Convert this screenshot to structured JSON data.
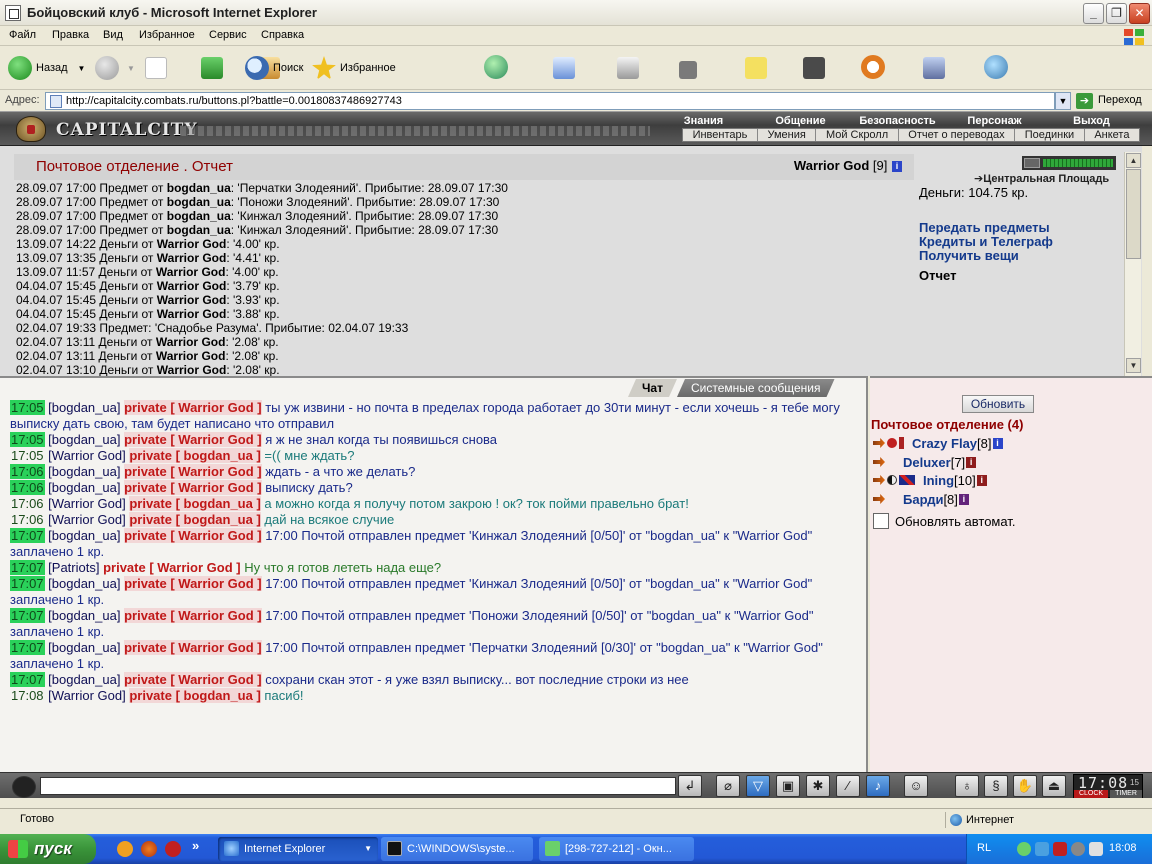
{
  "window": {
    "title": "Бойцовский клуб - Microsoft Internet Explorer",
    "min_glyph": "_",
    "max_glyph": "❐",
    "close_glyph": "✕"
  },
  "menu": [
    "Файл",
    "Правка",
    "Вид",
    "Избранное",
    "Сервис",
    "Справка"
  ],
  "toolbar": {
    "back": "Назад",
    "search": "Поиск",
    "favorites": "Избранное"
  },
  "address": {
    "label": "Адрес:",
    "url": "http://capitalcity.combats.ru/buttons.pl?battle=0.00180837486927743",
    "go": "Переход"
  },
  "game": {
    "logo": "CAPITALCITY",
    "nav_top": [
      "Знания",
      "Общение",
      "Безопасность",
      "Персонаж",
      "Выход"
    ],
    "nav_bottom": [
      "Инвентарь",
      "Умения",
      "Мой Скролл",
      "Отчет о переводах",
      "Поединки",
      "Анкета"
    ]
  },
  "main": {
    "title": "Почтовое отделение .  Отчет",
    "user_name": "Warrior God",
    "user_level": "[9]",
    "hp_percent": 100,
    "location": "Центральная Площадь",
    "money": "Деньги: 104.75 кр.",
    "links": [
      "Передать предметы",
      "Кредиты и Телеграф",
      "Получить вещи"
    ],
    "current": "Отчет",
    "log": [
      {
        "date": "28.09.07 17:00",
        "kind": "Предмет от",
        "who": "bogdan_ua",
        "rest": ": 'Перчатки Злодеяний'. Прибытие: 28.09.07 17:30"
      },
      {
        "date": "28.09.07 17:00",
        "kind": "Предмет от",
        "who": "bogdan_ua",
        "rest": ": 'Поножи Злодеяний'. Прибытие: 28.09.07 17:30"
      },
      {
        "date": "28.09.07 17:00",
        "kind": "Предмет от",
        "who": "bogdan_ua",
        "rest": ": 'Кинжал Злодеяний'. Прибытие: 28.09.07 17:30"
      },
      {
        "date": "28.09.07 17:00",
        "kind": "Предмет от",
        "who": "bogdan_ua",
        "rest": ": 'Кинжал Злодеяний'. Прибытие: 28.09.07 17:30"
      },
      {
        "date": "13.09.07 14:22",
        "kind": "Деньги от",
        "who": "Warrior God",
        "rest": ": '4.00' кр."
      },
      {
        "date": "13.09.07 13:35",
        "kind": "Деньги от",
        "who": "Warrior God",
        "rest": ": '4.41' кр."
      },
      {
        "date": "13.09.07 11:57",
        "kind": "Деньги от",
        "who": "Warrior God",
        "rest": ": '4.00' кр."
      },
      {
        "date": "04.04.07 15:45",
        "kind": "Деньги от",
        "who": "Warrior God",
        "rest": ": '3.79' кр."
      },
      {
        "date": "04.04.07 15:45",
        "kind": "Деньги от",
        "who": "Warrior God",
        "rest": ": '3.93' кр."
      },
      {
        "date": "04.04.07 15:45",
        "kind": "Деньги от",
        "who": "Warrior God",
        "rest": ": '3.88' кр."
      },
      {
        "date": "02.04.07 19:33",
        "kind": "Предмет:",
        "who": "",
        "rest": " 'Снадобье Разума'. Прибытие: 02.04.07 19:33"
      },
      {
        "date": "02.04.07 13:11",
        "kind": "Деньги от",
        "who": "Warrior God",
        "rest": ": '2.08' кр."
      },
      {
        "date": "02.04.07 13:11",
        "kind": "Деньги от",
        "who": "Warrior God",
        "rest": ": '2.08' кр."
      },
      {
        "date": "02.04.07 13:10",
        "kind": "Деньги от",
        "who": "Warrior God",
        "rest": ": '2.08' кр."
      }
    ]
  },
  "chat": {
    "tabs": [
      "Чат",
      "Системные сообщения"
    ],
    "messages": [
      {
        "time": "17:05",
        "hl": true,
        "nick": "bogdan_ua",
        "to": "private [ Warrior God ]",
        "text": "ты уж извини - но почта в пределах города работает до 30ти минут - если хочешь - я тебе могу выписку дать свою, там будет написано что отправил",
        "color": "blue"
      },
      {
        "time": "17:05",
        "hl": true,
        "nick": "bogdan_ua",
        "to": "private [ Warrior God ]",
        "text": "я ж не знал когда ты появишься снова",
        "color": "blue"
      },
      {
        "time": "17:05",
        "hl": false,
        "nick": "Warrior God",
        "to": "private [ bogdan_ua ]",
        "text": "=(( мне ждать?",
        "color": "teal"
      },
      {
        "time": "17:06",
        "hl": true,
        "nick": "bogdan_ua",
        "to": "private [ Warrior God ]",
        "text": "ждать - а что же делать?",
        "color": "blue"
      },
      {
        "time": "17:06",
        "hl": true,
        "nick": "bogdan_ua",
        "to": "private [ Warrior God ]",
        "text": "выписку дать?",
        "color": "blue"
      },
      {
        "time": "17:06",
        "hl": false,
        "nick": "Warrior God",
        "to": "private [ bogdan_ua ]",
        "text": "а можно когда я получу потом закрою ! ок? ток пойми правельно брат!",
        "color": "teal"
      },
      {
        "time": "17:06",
        "hl": false,
        "nick": "Warrior God",
        "to": "private [ bogdan_ua ]",
        "text": "дай на всякое случие",
        "color": "teal"
      },
      {
        "time": "17:07",
        "hl": true,
        "nick": "bogdan_ua",
        "to": "private [ Warrior God ]",
        "text": "17:00 Почтой отправлен предмет 'Кинжал Злодеяний [0/50]' от \"bogdan_ua\" к \"Warrior God\" заплачено 1 кр.",
        "color": "blue"
      },
      {
        "time": "17:07",
        "hl": true,
        "nick": "Patriots",
        "to": "private [ Warrior God ]",
        "text": "Ну что я готов лететь нада еще?",
        "color": "green"
      },
      {
        "time": "17:07",
        "hl": true,
        "nick": "bogdan_ua",
        "to": "private [ Warrior God ]",
        "text": "17:00 Почтой отправлен предмет 'Кинжал Злодеяний [0/50]' от \"bogdan_ua\" к \"Warrior God\" заплачено 1 кр.",
        "color": "blue"
      },
      {
        "time": "17:07",
        "hl": true,
        "nick": "bogdan_ua",
        "to": "private [ Warrior God ]",
        "text": "17:00 Почтой отправлен предмет 'Поножи Злодеяний [0/50]' от \"bogdan_ua\" к \"Warrior God\" заплачено 1 кр.",
        "color": "blue"
      },
      {
        "time": "17:07",
        "hl": true,
        "nick": "bogdan_ua",
        "to": "private [ Warrior God ]",
        "text": "17:00 Почтой отправлен предмет 'Перчатки Злодеяний [0/30]' от \"bogdan_ua\" к \"Warrior God\" заплачено 1 кр.",
        "color": "blue"
      },
      {
        "time": "17:07",
        "hl": true,
        "nick": "bogdan_ua",
        "to": "private [ Warrior God ]",
        "text": "сохрани скан этот - я уже взял выписку... вот последние строки из нее",
        "color": "blue"
      },
      {
        "time": "17:08",
        "hl": false,
        "nick": "Warrior God",
        "to": "private [ bogdan_ua ]",
        "text": "пасиб!",
        "color": "teal"
      }
    ]
  },
  "userlist": {
    "refresh": "Обновить",
    "title": "Почтовое отделение (4)",
    "users": [
      {
        "name": "Crazy Flay",
        "level": "[8]",
        "info": "blue"
      },
      {
        "name": "Deluxer",
        "level": "[7]",
        "info": "red"
      },
      {
        "name": "Ining",
        "level": "[10]",
        "info": "red"
      },
      {
        "name": "Барди",
        "level": "[8]",
        "info": "purple"
      }
    ],
    "auto_update": "Обновлять автомат."
  },
  "clock": {
    "time": "17:08",
    "seconds": "15",
    "label_clock": "CLOCK",
    "label_timer": "TIMER"
  },
  "status": {
    "ready": "Готово",
    "zone": "Интернет"
  },
  "taskbar": {
    "start": "пуск",
    "tasks": [
      "Internet Explorer",
      "C:\\WINDOWS\\syste...",
      "[298-727-212] - Окн..."
    ],
    "lang": "RL",
    "time": "18:08"
  },
  "colors": {
    "title_red": "#8f0000",
    "link_blue": "#143a8c",
    "private_red": "#c01818",
    "time_green": "#2ad15a"
  },
  "icons": {
    "info": "i",
    "down": "▼",
    "up": "▲"
  }
}
